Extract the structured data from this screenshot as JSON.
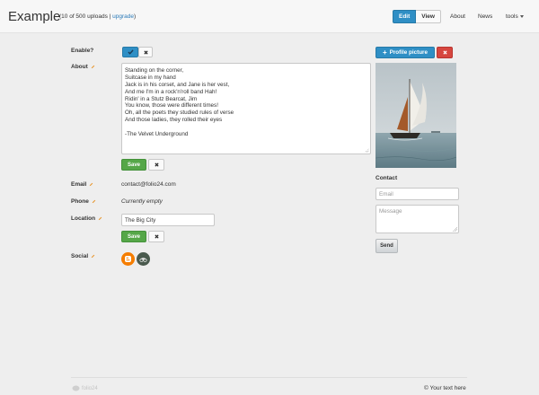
{
  "header": {
    "brand": "Example",
    "uploads_text": "(10 of 500 uploads | ",
    "upgrade_link": "upgrade",
    "uploads_close": ")",
    "mode_edit": "Edit",
    "mode_view": "View",
    "nav_about": "About",
    "nav_news": "News",
    "nav_tools": "tools"
  },
  "form": {
    "enable_label": "Enable?",
    "about_label": "About",
    "about_lines": [
      "Standing on the corner,",
      "Suitcase in my hand",
      "Jack is in his corset, and Jane is her vest,",
      "And me I'm in a rock'n'roll band Hah!",
      "Ridin' in a Stutz Bearcat, Jim",
      "You know, those were different times!",
      "Oh, all the poets they studied rules of verse",
      "And those ladies, they rolled their eyes",
      "",
      "-The Velvet Underground"
    ],
    "save_label": "Save",
    "email_label": "Email",
    "email_value": "contact@folio24.com",
    "phone_label": "Phone",
    "phone_value": "Currently empty",
    "location_label": "Location",
    "location_value": "The Big City",
    "social_label": "Social"
  },
  "sidebar": {
    "profile_picture_label": "Profile picture",
    "contact_heading": "Contact",
    "email_placeholder": "Email",
    "message_placeholder": "Message",
    "send_label": "Send"
  },
  "footer": {
    "logo_text": "folio24",
    "copyright": "© Your text here"
  },
  "colors": {
    "primary": "#2f8fc5",
    "success": "#55a748",
    "danger": "#d6463f",
    "blogger": "#f57d00",
    "tripadvisor": "#4a5a4e"
  }
}
